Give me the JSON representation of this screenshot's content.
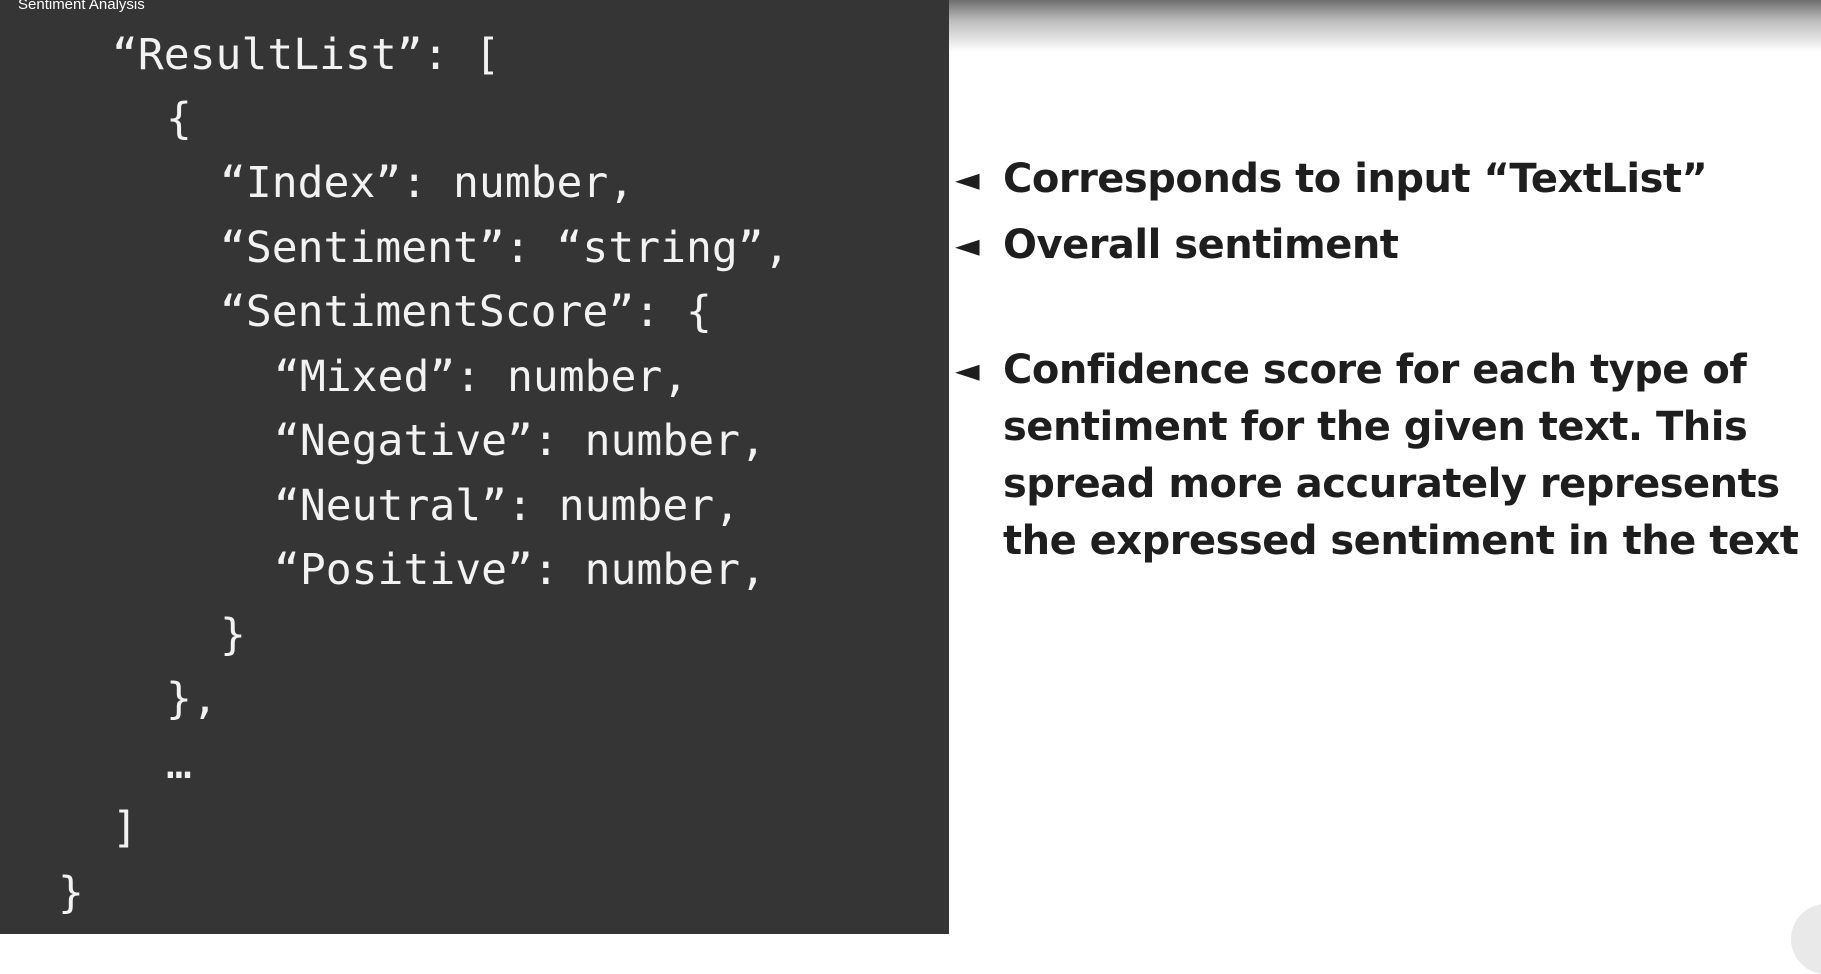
{
  "video": {
    "title": "Sentiment Analysis"
  },
  "code": {
    "lines": [
      "“ResultList”: [",
      "{",
      "“Index”: number,",
      "“Sentiment”: “string”,",
      "“SentimentScore”: {",
      "“Mixed”: number,",
      "“Negative”: number,",
      "“Neutral”: number,",
      "“Positive”: number,",
      "}",
      "},",
      "…",
      "]",
      "}"
    ]
  },
  "notes": [
    {
      "arrow": "◄",
      "text": "Corresponds to input “TextList”"
    },
    {
      "arrow": "◄",
      "text": "Overall sentiment"
    },
    {
      "arrow": "◄",
      "text": "Confidence score for each type of sentiment for the given text. This spread more accurately represents the expressed sentiment in the text"
    }
  ],
  "colors": {
    "code_background": "#353535",
    "code_text": "#f2f2f2",
    "notes_background": "#ffffff",
    "notes_text": "#1e1e1e"
  }
}
